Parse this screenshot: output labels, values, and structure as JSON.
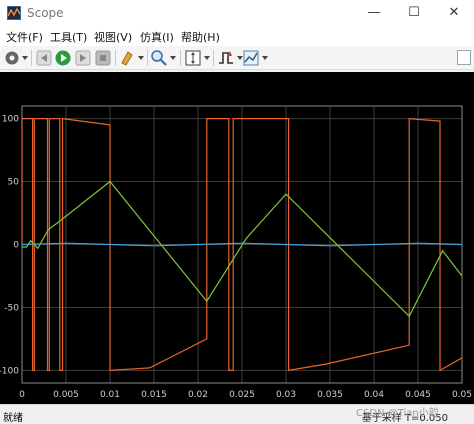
{
  "window": {
    "title": "Scope"
  },
  "menu": [
    "文件(F)",
    "工具(T)",
    "视图(V)",
    "仿真(I)",
    "帮助(H)"
  ],
  "status": {
    "left": "就绪",
    "right": "基于采样  T=0.050"
  },
  "watermark": "CSDN @Tian小韵",
  "colors": {
    "series_square": "#e8642c",
    "series_triangle": "#7ec83a",
    "series_flat": "#3ea6e0",
    "grid": "#3c3c3c",
    "axis_text": "#cfcfcf"
  },
  "icons": [
    "settings-icon",
    "step-back-icon",
    "run-icon",
    "step-forward-icon",
    "stop-icon",
    "highlight-icon",
    "zoom-icon",
    "autoscale-icon",
    "triggers-icon",
    "cursor-measure-icon"
  ],
  "chart_data": {
    "type": "line",
    "xlim": [
      0,
      0.05
    ],
    "ylim": [
      -110,
      110
    ],
    "xticks": [
      "0",
      "0.005",
      "0.01",
      "0.015",
      "0.02",
      "0.025",
      "0.03",
      "0.035",
      "0.04",
      "0.045",
      "0.05"
    ],
    "yticks": [
      "100",
      "50",
      "0",
      "-50",
      "-100"
    ],
    "grid": true,
    "series": [
      {
        "x": [
          0,
          0,
          0.0012,
          0.0012,
          0.0014,
          0.0014,
          0.0029,
          0.0029,
          0.0031,
          0.0031,
          0.0043,
          0.0043,
          0.0046,
          0.0046,
          0.01,
          0.01,
          0.0145,
          0.021,
          0.021,
          0.0235,
          0.0235,
          0.024,
          0.024,
          0.0303,
          0.0303,
          0.0345,
          0.044,
          0.044,
          0.0475,
          0.0475,
          0.05
        ],
        "y": [
          0,
          100,
          100,
          -100,
          -100,
          100,
          100,
          -100,
          -100,
          100,
          100,
          -100,
          -100,
          100,
          95,
          -100,
          -98,
          -75,
          100,
          100,
          -100,
          -100,
          100,
          100,
          -100,
          -95,
          -80,
          100,
          98,
          -100,
          -90
        ]
      },
      {
        "x": [
          0,
          0.0005,
          0.001,
          0.0018,
          0.003,
          0.004,
          0.01,
          0.021,
          0.0255,
          0.03,
          0.044,
          0.0478,
          0.05
        ],
        "y": [
          -2,
          -2,
          3,
          -3,
          12,
          17,
          50,
          -45,
          5,
          40,
          -57,
          -5,
          -25
        ]
      },
      {
        "x": [
          0,
          0.005,
          0.01,
          0.015,
          0.02,
          0.025,
          0.03,
          0.035,
          0.04,
          0.045,
          0.05
        ],
        "y": [
          0,
          1,
          0,
          -1,
          0,
          1,
          0,
          -1,
          0,
          1,
          0
        ]
      }
    ]
  }
}
